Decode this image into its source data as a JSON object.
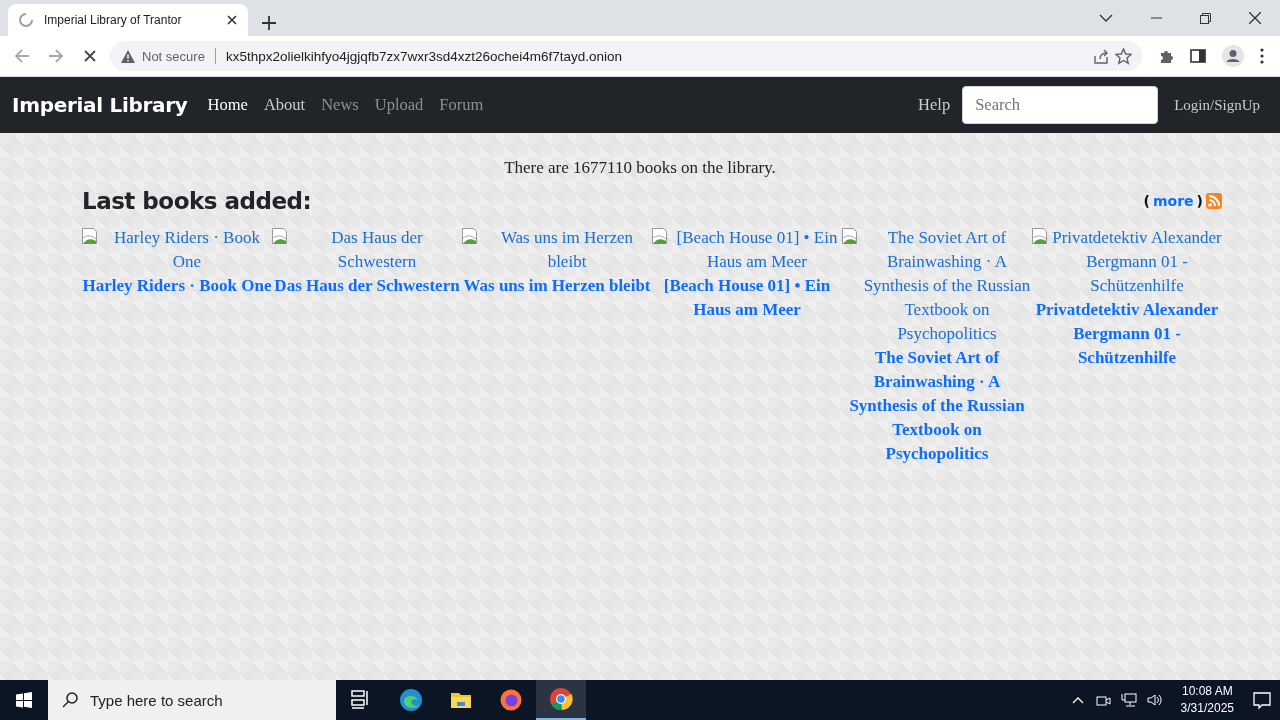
{
  "browser": {
    "tab_title": "Imperial Library of Trantor",
    "security": "Not secure",
    "url": "kx5thpx2olielkihfyo4jgjqfb7zx7wxr3sd4xzt26ochei4m6f7tayd.onion"
  },
  "navbar": {
    "brand": "Imperial Library",
    "links": [
      {
        "label": "Home",
        "selected": true
      },
      {
        "label": "About",
        "selected": false
      },
      {
        "label": "News",
        "selected": false
      },
      {
        "label": "Upload",
        "selected": false
      },
      {
        "label": "Forum",
        "selected": false
      }
    ],
    "help": "Help",
    "search": {
      "placeholder": "Search"
    },
    "login": "Login/SignUp"
  },
  "summary": "There are 1677110 books on the library.",
  "last_books": {
    "heading": "Last books added:",
    "more": "more",
    "open_paren": "(",
    "close_paren": ")",
    "books": [
      {
        "alt": "Harley Riders · Book One",
        "title": "Harley Riders · Book One"
      },
      {
        "alt": "Das Haus der Schwestern",
        "title": "Das Haus der Schwestern"
      },
      {
        "alt": "Was uns im Herzen bleibt",
        "title": "Was uns im Herzen bleibt"
      },
      {
        "alt": "[Beach House 01] • Ein Haus am Meer",
        "title": "[Beach House 01] • Ein Haus am Meer"
      },
      {
        "alt": "The Soviet Art of Brainwashing · A Synthesis of the Russian Textbook on Psychopolitics",
        "title": "The Soviet Art of Brainwashing · A Synthesis of the Russian Textbook on Psychopolitics"
      },
      {
        "alt": "Privatdetektiv Alexander Bergmann 01 - Schützenhilfe",
        "title": "Privatdetektiv Alexander Bergmann 01 - Schützenhilfe"
      }
    ]
  },
  "taskbar": {
    "search_placeholder": "Type here to search",
    "time": "10:08 AM",
    "date": "3/31/2025"
  }
}
